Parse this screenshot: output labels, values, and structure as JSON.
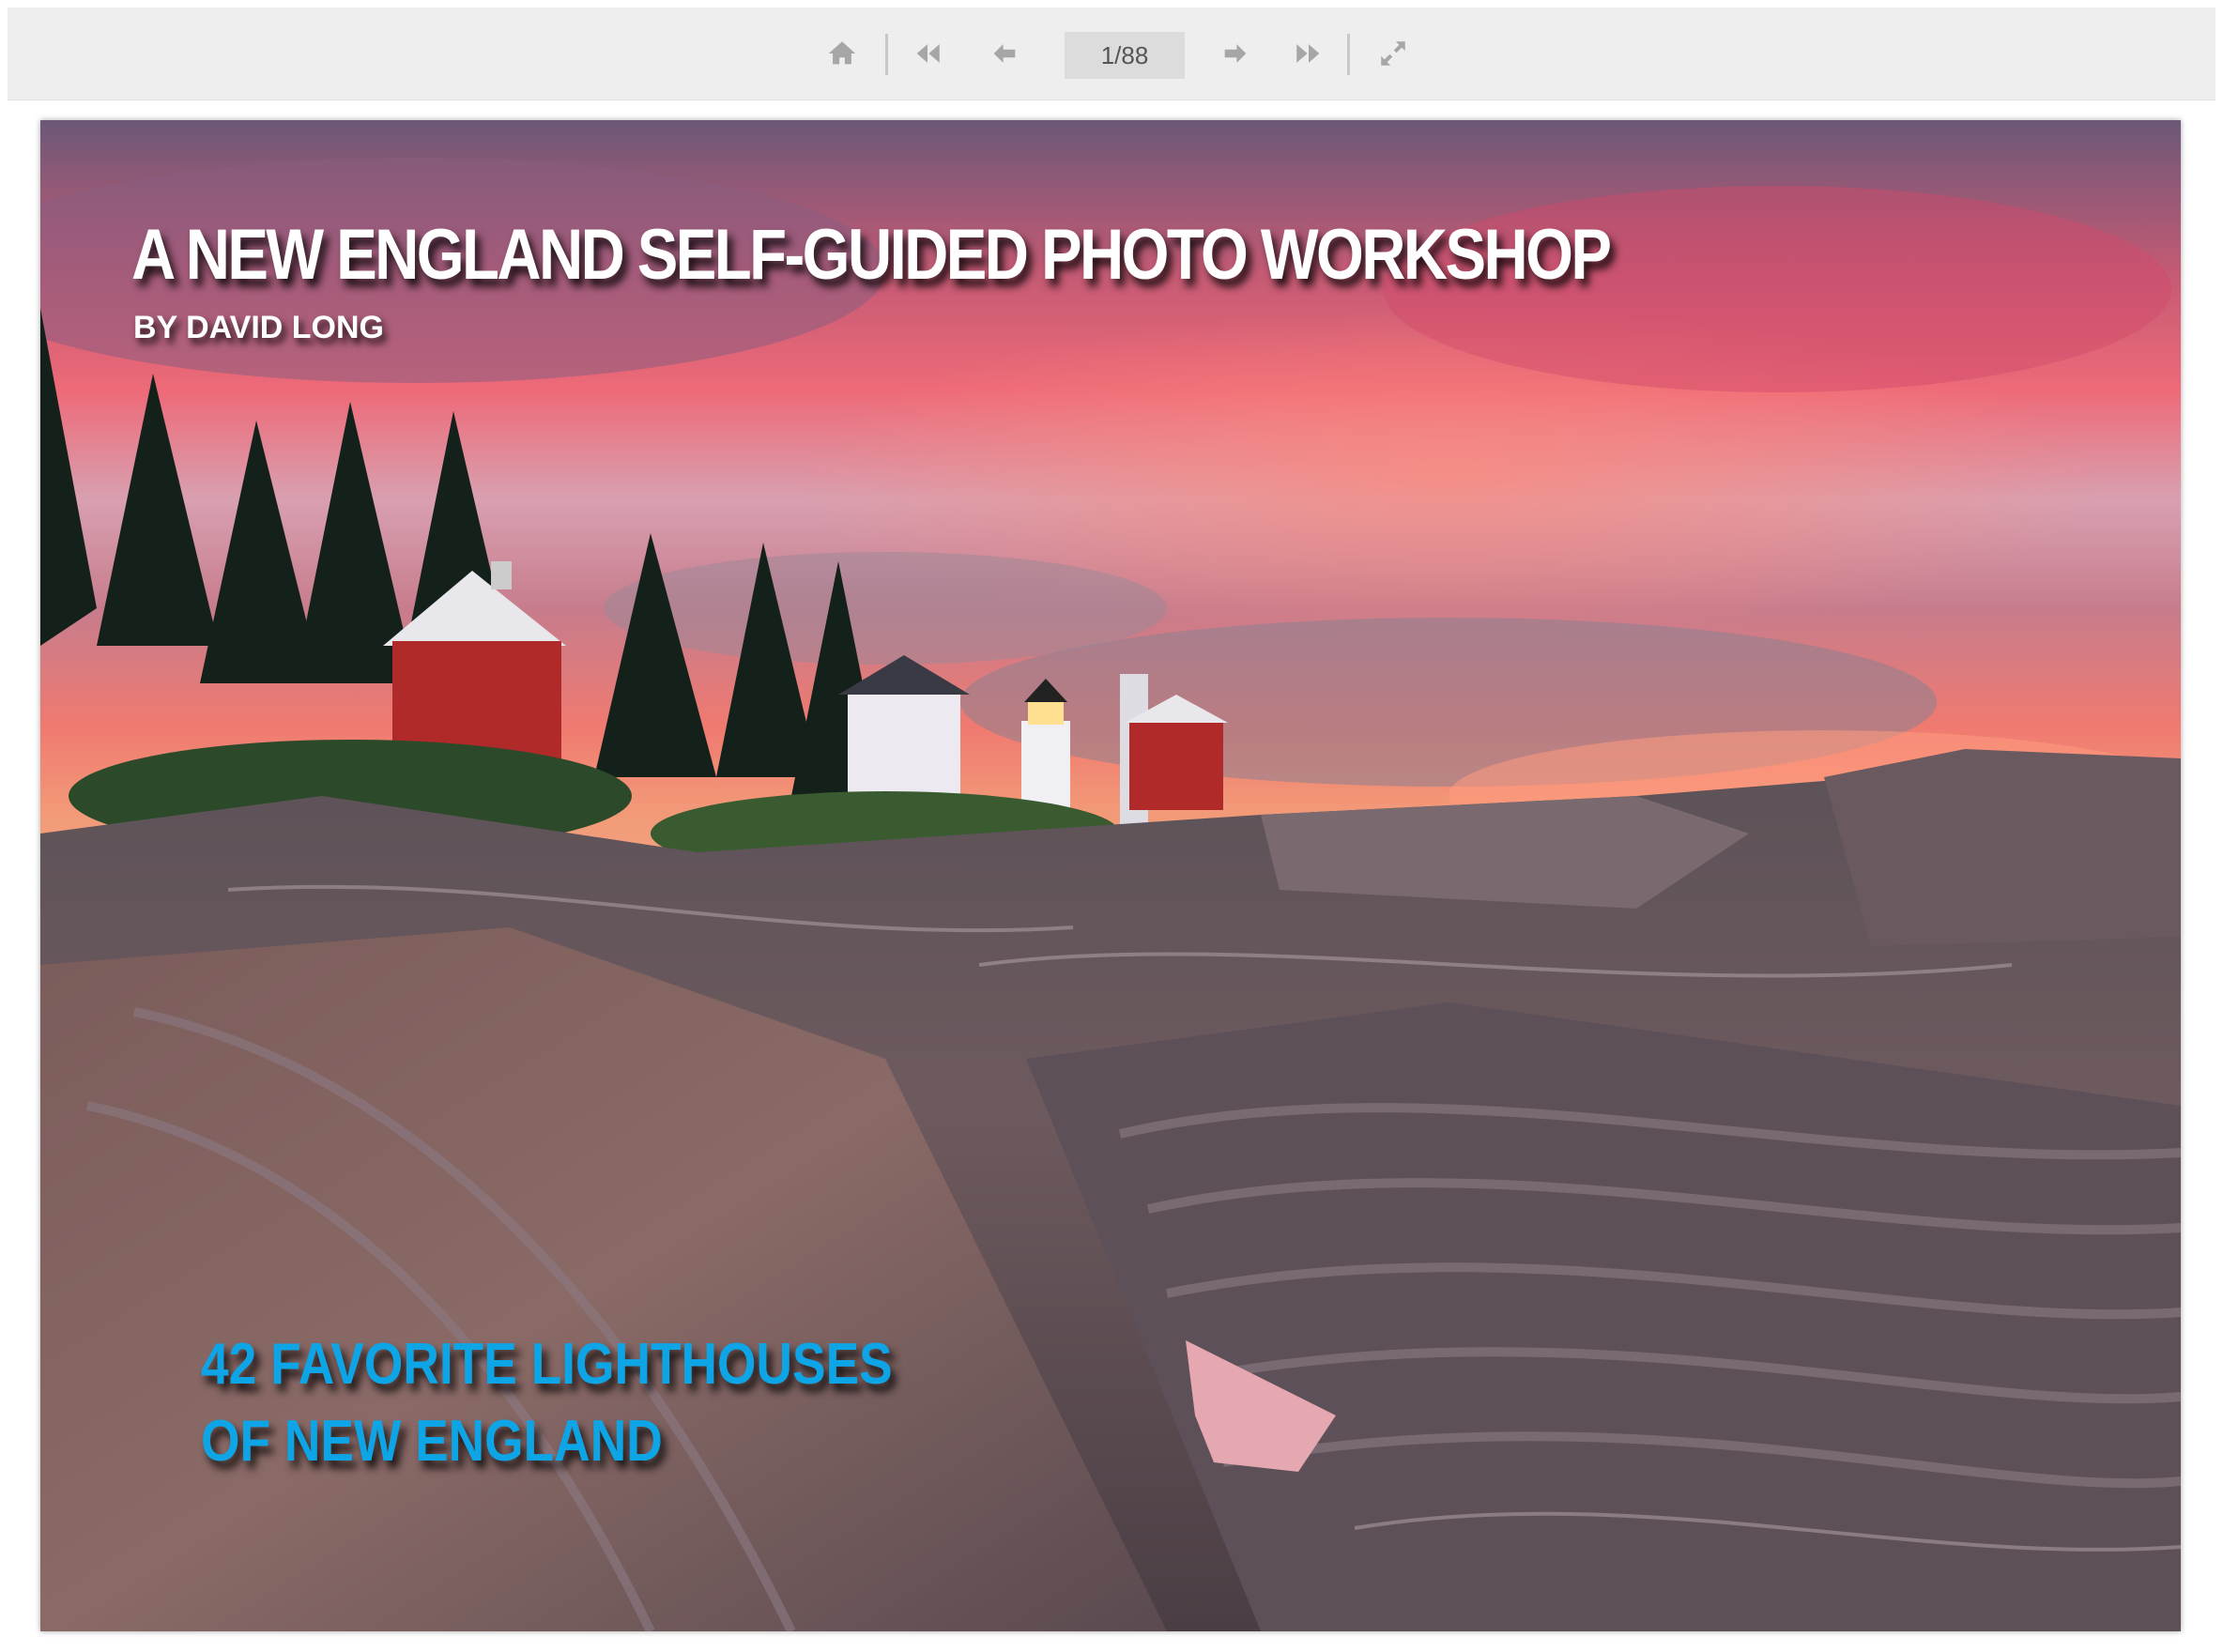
{
  "toolbar": {
    "page_indicator": "1/88",
    "buttons": [
      {
        "name": "home",
        "icon": "home-icon"
      },
      {
        "name": "first-page",
        "icon": "double-chevron-left-icon"
      },
      {
        "name": "previous-page",
        "icon": "arrow-left-icon"
      },
      {
        "name": "next-page",
        "icon": "arrow-right-icon"
      },
      {
        "name": "last-page",
        "icon": "double-chevron-right-icon"
      },
      {
        "name": "fullscreen",
        "icon": "expand-icon"
      }
    ],
    "icon_color": "#a6a6a6",
    "background": "#eeeeee"
  },
  "page": {
    "title": "A NEW ENGLAND SELF-GUIDED PHOTO WORKSHOP",
    "byline": "BY DAVID LONG",
    "subtitle_line1": "42 FAVORITE LIGHTHOUSES",
    "subtitle_line2": "OF NEW ENGLAND",
    "subtitle_color": "#0ea5e6"
  }
}
